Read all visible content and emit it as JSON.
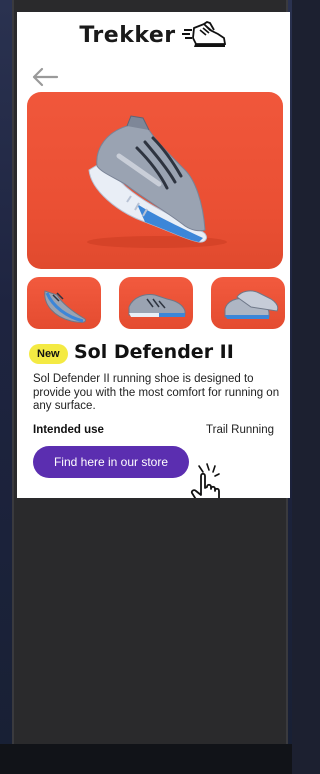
{
  "app": {
    "brand": "Trekker",
    "logo_icon": "running-shoe-icon"
  },
  "navigation": {
    "back_icon": "arrow-left-icon"
  },
  "product": {
    "badge": "New",
    "name": "Sol Defender II",
    "description": "Sol Defender II running shoe is designed to provide you with the most comfort for running on any surface.",
    "intended_use_label": "Intended use",
    "intended_use_value": "Trail Running",
    "hero_image": "running-shoe-photo",
    "thumbnails": [
      {
        "icon": "shoe-angle-1-photo"
      },
      {
        "icon": "shoe-side-photo"
      },
      {
        "icon": "shoe-pair-photo"
      }
    ]
  },
  "cta": {
    "label": "Find here in our store",
    "pointer_icon": "hand-pointer-icon"
  },
  "colors": {
    "accent": "#5b2eb0",
    "badge": "#f4ea43",
    "hero_bg": "#f0573b"
  }
}
